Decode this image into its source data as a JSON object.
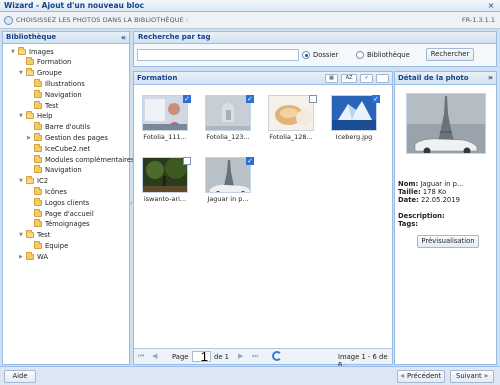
{
  "window": {
    "title": "Wizard - Ajout d'un nouveau bloc",
    "close_glyph": "×"
  },
  "step": {
    "label": "CHOISISSEZ LES PHOTOS DANS LA BIBLIOTHÈQUE :",
    "version": "FR-1.3.1.1"
  },
  "library": {
    "title": "Bibliothèque",
    "collapse_glyph": "«",
    "items": [
      {
        "label": "Images",
        "level": 0,
        "expanded": true
      },
      {
        "label": "Formation",
        "level": 1,
        "expanded": false
      },
      {
        "label": "Groupe",
        "level": 1,
        "expanded": true
      },
      {
        "label": "Illustrations",
        "level": 2,
        "expanded": false
      },
      {
        "label": "Navigation",
        "level": 2,
        "expanded": false
      },
      {
        "label": "Test",
        "level": 2,
        "expanded": false
      },
      {
        "label": "Help",
        "level": 1,
        "expanded": true
      },
      {
        "label": "Barre d'outils",
        "level": 2,
        "expanded": false
      },
      {
        "label": "Gestion des pages",
        "level": 2,
        "expanded": false,
        "has_children": true
      },
      {
        "label": "IceCube2.net",
        "level": 2,
        "expanded": false
      },
      {
        "label": "Modules complémentaires",
        "level": 2,
        "expanded": false
      },
      {
        "label": "Navigation",
        "level": 2,
        "expanded": false
      },
      {
        "label": "IC2",
        "level": 1,
        "expanded": true
      },
      {
        "label": "Icônes",
        "level": 2,
        "expanded": false
      },
      {
        "label": "Logos clients",
        "level": 2,
        "expanded": false
      },
      {
        "label": "Page d'accueil",
        "level": 2,
        "expanded": false
      },
      {
        "label": "Témoignages",
        "level": 2,
        "expanded": false
      },
      {
        "label": "Test",
        "level": 1,
        "expanded": true
      },
      {
        "label": "Equipe",
        "level": 2,
        "expanded": false
      },
      {
        "label": "WA",
        "level": 1,
        "expanded": false,
        "has_children": true
      }
    ]
  },
  "search": {
    "title": "Recherche par tag",
    "value": "",
    "radio_folder": "Dossier",
    "radio_library": "Bibliothèque",
    "selected": "Dossier",
    "button": "Rechercher"
  },
  "gallery": {
    "title": "Formation",
    "toolbar": {
      "sort_label": "AZ",
      "view_glyph": "▦",
      "check_glyph": "✓",
      "blank_glyph": ""
    },
    "photos": [
      {
        "caption": "Fotolia_111...",
        "checked": true,
        "kind": "office"
      },
      {
        "caption": "Fotolia_123...",
        "checked": true,
        "kind": "grey"
      },
      {
        "caption": "Fotolia_128...",
        "checked": false,
        "kind": "bread"
      },
      {
        "caption": "Iceberg.jpg",
        "checked": true,
        "kind": "iceberg"
      },
      {
        "caption": "iswanto-ari...",
        "checked": false,
        "kind": "forest"
      },
      {
        "caption": "Jaguar in p...",
        "checked": true,
        "kind": "paris"
      }
    ],
    "pager": {
      "page_label": "Page",
      "page_value": "1",
      "of_label": "de 1",
      "status": "Image 1 - 6 de 6",
      "first": "⏮",
      "prev": "◀",
      "next": "▶",
      "last": "⏭"
    }
  },
  "detail": {
    "title": "Détail de la photo",
    "expand_glyph": "»",
    "name_label": "Nom:",
    "name_value": "Jaguar in p...",
    "size_label": "Taille:",
    "size_value": "178 Ko",
    "date_label": "Date:",
    "date_value": "22.05.2019",
    "desc_label": "Description:",
    "tags_label": "Tags:",
    "preview_button": "Prévisualisation"
  },
  "footer": {
    "help": "Aide",
    "previous": "« Précédent",
    "next": "Suivant »"
  },
  "colors": {
    "accent": "#15428b",
    "border": "#99bbe8",
    "check": "#2c6fd0"
  }
}
